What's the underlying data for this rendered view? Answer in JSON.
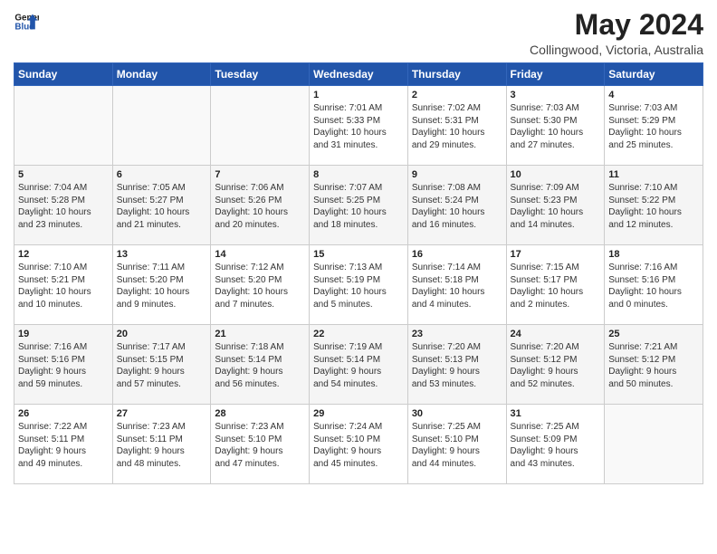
{
  "header": {
    "logo_line1": "General",
    "logo_line2": "Blue",
    "month": "May 2024",
    "location": "Collingwood, Victoria, Australia"
  },
  "weekdays": [
    "Sunday",
    "Monday",
    "Tuesday",
    "Wednesday",
    "Thursday",
    "Friday",
    "Saturday"
  ],
  "weeks": [
    [
      {
        "day": "",
        "info": ""
      },
      {
        "day": "",
        "info": ""
      },
      {
        "day": "",
        "info": ""
      },
      {
        "day": "1",
        "info": "Sunrise: 7:01 AM\nSunset: 5:33 PM\nDaylight: 10 hours\nand 31 minutes."
      },
      {
        "day": "2",
        "info": "Sunrise: 7:02 AM\nSunset: 5:31 PM\nDaylight: 10 hours\nand 29 minutes."
      },
      {
        "day": "3",
        "info": "Sunrise: 7:03 AM\nSunset: 5:30 PM\nDaylight: 10 hours\nand 27 minutes."
      },
      {
        "day": "4",
        "info": "Sunrise: 7:03 AM\nSunset: 5:29 PM\nDaylight: 10 hours\nand 25 minutes."
      }
    ],
    [
      {
        "day": "5",
        "info": "Sunrise: 7:04 AM\nSunset: 5:28 PM\nDaylight: 10 hours\nand 23 minutes."
      },
      {
        "day": "6",
        "info": "Sunrise: 7:05 AM\nSunset: 5:27 PM\nDaylight: 10 hours\nand 21 minutes."
      },
      {
        "day": "7",
        "info": "Sunrise: 7:06 AM\nSunset: 5:26 PM\nDaylight: 10 hours\nand 20 minutes."
      },
      {
        "day": "8",
        "info": "Sunrise: 7:07 AM\nSunset: 5:25 PM\nDaylight: 10 hours\nand 18 minutes."
      },
      {
        "day": "9",
        "info": "Sunrise: 7:08 AM\nSunset: 5:24 PM\nDaylight: 10 hours\nand 16 minutes."
      },
      {
        "day": "10",
        "info": "Sunrise: 7:09 AM\nSunset: 5:23 PM\nDaylight: 10 hours\nand 14 minutes."
      },
      {
        "day": "11",
        "info": "Sunrise: 7:10 AM\nSunset: 5:22 PM\nDaylight: 10 hours\nand 12 minutes."
      }
    ],
    [
      {
        "day": "12",
        "info": "Sunrise: 7:10 AM\nSunset: 5:21 PM\nDaylight: 10 hours\nand 10 minutes."
      },
      {
        "day": "13",
        "info": "Sunrise: 7:11 AM\nSunset: 5:20 PM\nDaylight: 10 hours\nand 9 minutes."
      },
      {
        "day": "14",
        "info": "Sunrise: 7:12 AM\nSunset: 5:20 PM\nDaylight: 10 hours\nand 7 minutes."
      },
      {
        "day": "15",
        "info": "Sunrise: 7:13 AM\nSunset: 5:19 PM\nDaylight: 10 hours\nand 5 minutes."
      },
      {
        "day": "16",
        "info": "Sunrise: 7:14 AM\nSunset: 5:18 PM\nDaylight: 10 hours\nand 4 minutes."
      },
      {
        "day": "17",
        "info": "Sunrise: 7:15 AM\nSunset: 5:17 PM\nDaylight: 10 hours\nand 2 minutes."
      },
      {
        "day": "18",
        "info": "Sunrise: 7:16 AM\nSunset: 5:16 PM\nDaylight: 10 hours\nand 0 minutes."
      }
    ],
    [
      {
        "day": "19",
        "info": "Sunrise: 7:16 AM\nSunset: 5:16 PM\nDaylight: 9 hours\nand 59 minutes."
      },
      {
        "day": "20",
        "info": "Sunrise: 7:17 AM\nSunset: 5:15 PM\nDaylight: 9 hours\nand 57 minutes."
      },
      {
        "day": "21",
        "info": "Sunrise: 7:18 AM\nSunset: 5:14 PM\nDaylight: 9 hours\nand 56 minutes."
      },
      {
        "day": "22",
        "info": "Sunrise: 7:19 AM\nSunset: 5:14 PM\nDaylight: 9 hours\nand 54 minutes."
      },
      {
        "day": "23",
        "info": "Sunrise: 7:20 AM\nSunset: 5:13 PM\nDaylight: 9 hours\nand 53 minutes."
      },
      {
        "day": "24",
        "info": "Sunrise: 7:20 AM\nSunset: 5:12 PM\nDaylight: 9 hours\nand 52 minutes."
      },
      {
        "day": "25",
        "info": "Sunrise: 7:21 AM\nSunset: 5:12 PM\nDaylight: 9 hours\nand 50 minutes."
      }
    ],
    [
      {
        "day": "26",
        "info": "Sunrise: 7:22 AM\nSunset: 5:11 PM\nDaylight: 9 hours\nand 49 minutes."
      },
      {
        "day": "27",
        "info": "Sunrise: 7:23 AM\nSunset: 5:11 PM\nDaylight: 9 hours\nand 48 minutes."
      },
      {
        "day": "28",
        "info": "Sunrise: 7:23 AM\nSunset: 5:10 PM\nDaylight: 9 hours\nand 47 minutes."
      },
      {
        "day": "29",
        "info": "Sunrise: 7:24 AM\nSunset: 5:10 PM\nDaylight: 9 hours\nand 45 minutes."
      },
      {
        "day": "30",
        "info": "Sunrise: 7:25 AM\nSunset: 5:10 PM\nDaylight: 9 hours\nand 44 minutes."
      },
      {
        "day": "31",
        "info": "Sunrise: 7:25 AM\nSunset: 5:09 PM\nDaylight: 9 hours\nand 43 minutes."
      },
      {
        "day": "",
        "info": ""
      }
    ]
  ]
}
